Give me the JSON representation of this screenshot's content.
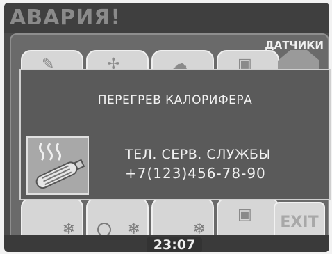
{
  "header": {
    "title": "АВАРИЯ!"
  },
  "panel": {
    "sensors_tab": "ДАТЧИКИ",
    "exit_label": "EXIT"
  },
  "alarm": {
    "message": "ПЕРЕГРЕВ КАЛОРИФЕРА",
    "icon": "heater-overheat-icon",
    "service_label": "ТЕЛ. СЕРВ. СЛУЖБЫ",
    "service_phone": "+7(123)456-78-90"
  },
  "status": {
    "time": "23:07"
  },
  "colors": {
    "screen_bg": "#4b4b4b",
    "dialog_bg": "#5a5a5a",
    "text": "#f2f2f2"
  }
}
